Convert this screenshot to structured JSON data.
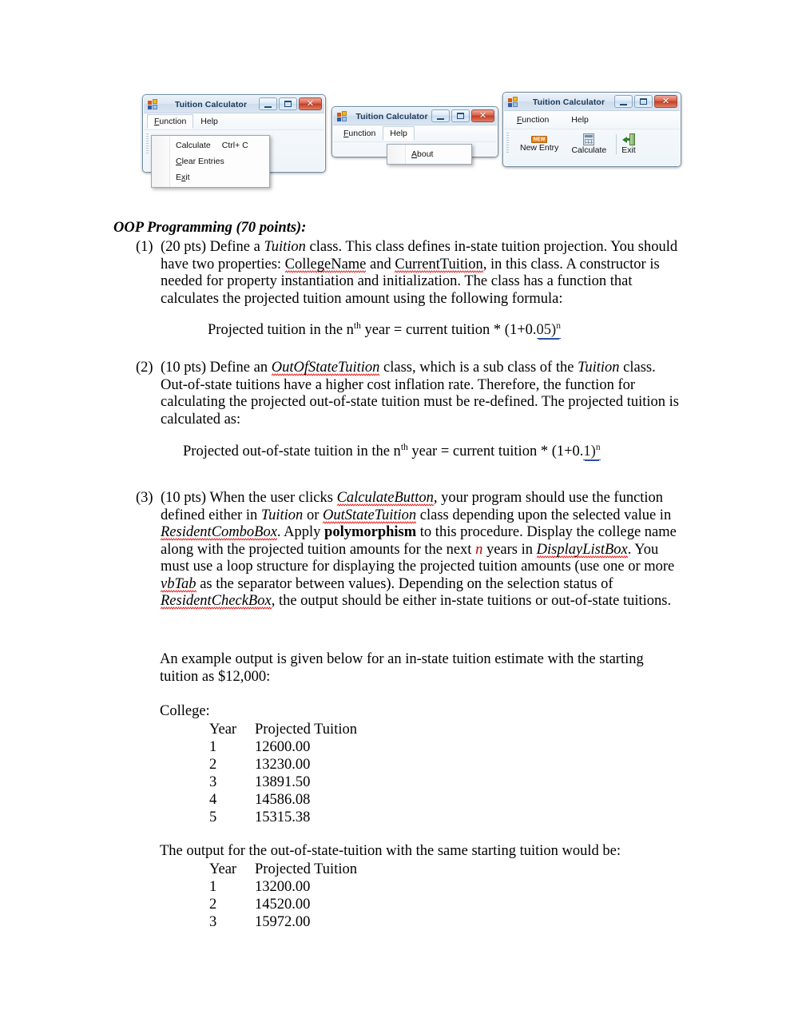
{
  "windows": [
    {
      "id": "window-function-menu",
      "title": "Tuition Calculator",
      "icon": "vb-form-icon",
      "buttons": {
        "minimize": "minimize-button",
        "maximize": "maximize-button",
        "close": "close-button",
        "close_glyph": "✕"
      },
      "menus": [
        {
          "label": "Function",
          "accel": "F",
          "open": true
        },
        {
          "label": "Help",
          "accel": "H",
          "open": false
        }
      ],
      "dropdown": {
        "owner": "Function",
        "items": [
          {
            "label": "Calculate",
            "accel": "",
            "shortcut": "Ctrl+ C"
          },
          {
            "label": "Clear Entries",
            "accel": "C",
            "shortcut": ""
          },
          {
            "label": "Exit",
            "accel": "x",
            "shortcut": ""
          }
        ]
      }
    },
    {
      "id": "window-help-menu",
      "title": "Tuition Calculator",
      "icon": "vb-form-icon",
      "buttons": {
        "minimize": "minimize-button",
        "maximize": "maximize-button",
        "close": "close-button",
        "close_glyph": "✕"
      },
      "menus": [
        {
          "label": "Function",
          "accel": "F",
          "open": false
        },
        {
          "label": "Help",
          "accel": "H",
          "open": true
        }
      ],
      "dropdown": {
        "owner": "Help",
        "items": [
          {
            "label": "About",
            "accel": "A",
            "shortcut": ""
          }
        ]
      }
    },
    {
      "id": "window-toolbar",
      "title": "Tuition Calculator",
      "icon": "vb-form-icon",
      "buttons": {
        "minimize": "minimize-button",
        "maximize": "maximize-button",
        "close": "close-button",
        "close_glyph": "✕"
      },
      "menus": [
        {
          "label": "Function",
          "accel": "F",
          "open": false
        },
        {
          "label": "Help",
          "accel": "H",
          "open": false
        }
      ],
      "toolbar": [
        {
          "label": "New Entry",
          "icon": "new-icon",
          "badge": "NEW"
        },
        {
          "label": "Calculate",
          "icon": "calculator-icon",
          "badge": ""
        },
        {
          "label": "Exit",
          "icon": "exit-door-icon",
          "badge": ""
        }
      ]
    }
  ],
  "document": {
    "heading": "OOP Programming (70 points):",
    "item1": {
      "number": "(1)",
      "t1": "(20 pts) Define a ",
      "em1": "Tuition",
      "t2": " class. This class defines in-state tuition projection. You should have two properties: ",
      "sp1": "CollegeName",
      "t3": " and ",
      "sp2": "CurrentTuition",
      "t4": ", in this class. A constructor is needed for property instantiation and initialization. The class has a function that calculates the projected tuition amount using the following formula:"
    },
    "formula1": {
      "pre": "Projected tuition in the n",
      "sup": "th",
      "mid": " year = current tuition * (1+0.",
      "link": "05)",
      "link_sup": "n"
    },
    "item2": {
      "number": "(2)",
      "t1": "(10 pts) Define an ",
      "sp1": "OutOfStateTuition",
      "t2": " class, which is a sub class of the ",
      "em1": "Tuition",
      "t3": " class. Out-of-state tuitions have a higher cost inflation rate. Therefore, the function for calculating the projected out-of-state tuition must be re-defined. The projected tuition is calculated as:"
    },
    "formula2": {
      "pre": "Projected out-of-state tuition in the n",
      "sup": "th",
      "mid": " year = current tuition * (1+0.",
      "link": "1)",
      "link_sup": "n"
    },
    "item3": {
      "number": "(3)",
      "t1": "(10 pts) When the user clicks ",
      "sp1": "CalculateButton",
      "t2": ", your program should use the function defined either in ",
      "em1": "Tuition",
      "t3": " or ",
      "sp2": "OutStateTuition",
      "t4": " class depending upon the selected value in ",
      "sp3": "ResidentComboBox",
      "t5": ". Apply ",
      "bold1": "polymorphism",
      "t6": " to this procedure. Display the college name along with the projected tuition amounts for the next ",
      "var_n": "n",
      "t7": " years in ",
      "sp4": "DisplayListBox",
      "t8": ". You must use a loop structure for displaying the projected tuition amounts (use one or more ",
      "sp5": "vbTab",
      "t9": " as the separator between values). Depending on the selection status of ",
      "sp6": "ResidentCheckBox",
      "t10": ", the output should be either in-state tuitions or out-of-state tuitions."
    },
    "example_intro": "An example output is given below for an in-state tuition estimate with the starting tuition as $12,000:",
    "college_label": "College:",
    "instate_table": {
      "headers": [
        "Year",
        "Projected Tuition"
      ],
      "rows": [
        [
          "1",
          "12600.00"
        ],
        [
          "2",
          "13230.00"
        ],
        [
          "3",
          "13891.50"
        ],
        [
          "4",
          "14586.08"
        ],
        [
          "5",
          "15315.38"
        ]
      ]
    },
    "outstate_intro": "The output for the out-of-state-tuition with the same starting tuition would be:",
    "outstate_table": {
      "headers": [
        "Year",
        "Projected Tuition"
      ],
      "rows": [
        [
          "1",
          "13200.00"
        ],
        [
          "2",
          "14520.00"
        ],
        [
          "3",
          "15972.00"
        ]
      ]
    }
  }
}
